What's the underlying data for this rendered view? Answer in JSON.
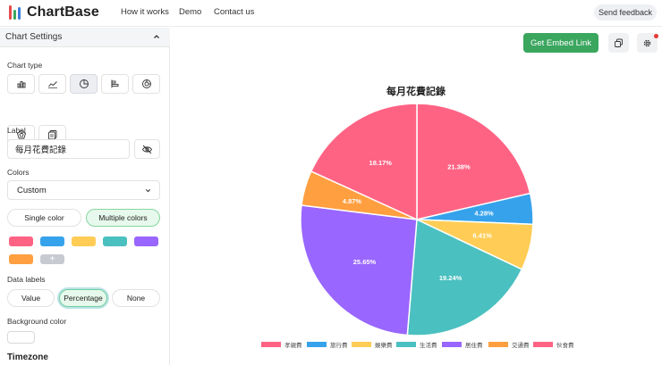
{
  "app": {
    "name": "ChartBase",
    "logo_colors": [
      "#e54b4b",
      "#3aa65e",
      "#3b7ddd"
    ]
  },
  "nav": {
    "items": [
      "How it works",
      "Demo",
      "Contact us"
    ],
    "feedback_label": "Send feedback"
  },
  "sidebar": {
    "title": "Chart Settings",
    "chart_type_label": "Chart type",
    "chart_types": [
      {
        "icon": "bar-chart-icon",
        "active": false
      },
      {
        "icon": "line-chart-icon",
        "active": false
      },
      {
        "icon": "pie-chart-icon",
        "active": true
      },
      {
        "icon": "horizontal-bar-chart-icon",
        "active": false
      },
      {
        "icon": "doughnut-chart-icon",
        "active": false
      },
      {
        "icon": "radar-chart-icon",
        "active": false
      },
      {
        "icon": "table-chart-icon",
        "active": false
      }
    ],
    "label_label": "Label",
    "label_value": "每月花費記錄",
    "colors_label": "Colors",
    "colors_select": "Custom",
    "color_mode": {
      "single": "Single color",
      "multiple": "Multiple colors",
      "selected": "multiple"
    },
    "swatches": [
      "#ff6384",
      "#36a2eb",
      "#ffcd56",
      "#4bc0c0",
      "#9966ff",
      "#ff9f40"
    ],
    "add_swatch": "+",
    "data_labels_label": "Data labels",
    "data_labels": {
      "value": "Value",
      "percentage": "Percentage",
      "none": "None",
      "selected": "percentage"
    },
    "background_label": "Background color",
    "timezone_label": "Timezone"
  },
  "main": {
    "embed_label": "Get Embed Link"
  },
  "chart_data": {
    "type": "pie",
    "title": "每月花費記錄",
    "legend_position": "bottom",
    "data_labels": "percentage",
    "slice_order": "clockwise from top",
    "categories": [
      "孝親費",
      "旅行費",
      "娛樂費",
      "生活費",
      "居住費",
      "交通費",
      "伙食費"
    ],
    "values": [
      21.38,
      4.28,
      6.41,
      19.24,
      25.65,
      4.87,
      18.17
    ],
    "labels": [
      "21.38%",
      "4.28%",
      "6.41%",
      "19.24%",
      "25.65%",
      "4.87%",
      "18.17%"
    ],
    "colors": [
      "#ff6384",
      "#36a2eb",
      "#ffcd56",
      "#4bc0c0",
      "#9966ff",
      "#ff9f40",
      "#ff6384"
    ]
  }
}
